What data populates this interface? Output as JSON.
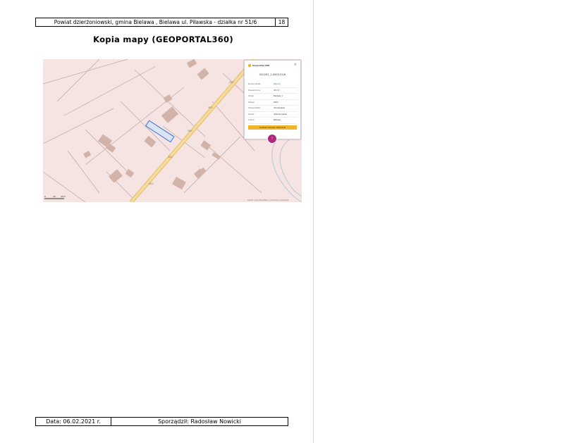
{
  "header": {
    "location": "Powiat dzierżoniowski, gmina Bielawa , Bielawa ul. Piławska - działka nr 51/6",
    "page_number": "18"
  },
  "title": "Kopia mapy (GEOPORTAL360)",
  "map": {
    "popup": {
      "brand": "Geoportal 360",
      "close": "×",
      "parcel_id": "020202_1.0003.51/6",
      "rows": [
        {
          "key": "Rodzaj działki",
          "value": "Szkolny"
        },
        {
          "key": "Powierzchnia",
          "value": "431 m²"
        },
        {
          "key": "Obręb",
          "value": "Bielawa_1"
        },
        {
          "key": "Obszar",
          "value": "0003"
        },
        {
          "key": "Województwo",
          "value": "dolnośląskie"
        },
        {
          "key": "Powiat",
          "value": "dzierżoniowski"
        },
        {
          "key": "Gmina",
          "value": "Bielawa"
        },
        {
          "key": "Kategoria",
          "value": "gmina miejska"
        }
      ],
      "button_label": "RAPORT DZIAŁKI PREMIUM"
    },
    "pin_label": "!",
    "road_labels": [
      "382"
    ],
    "scale_labels": [
      "0",
      "20",
      "40m"
    ],
    "attribution": "Leaflet | OpenStreetMap contributors | Geoportal"
  },
  "footer": {
    "date": "Data: 06.02.2021 r.",
    "author": "Sporządził: Radosław Nowicki"
  },
  "colors": {
    "map_background": "#f6e4e3",
    "building": "#d2b3aa",
    "road": "#e8c77a",
    "selected_parcel": "#3b6fd4",
    "pin": "#b0267c",
    "button": "#f2b52a"
  }
}
